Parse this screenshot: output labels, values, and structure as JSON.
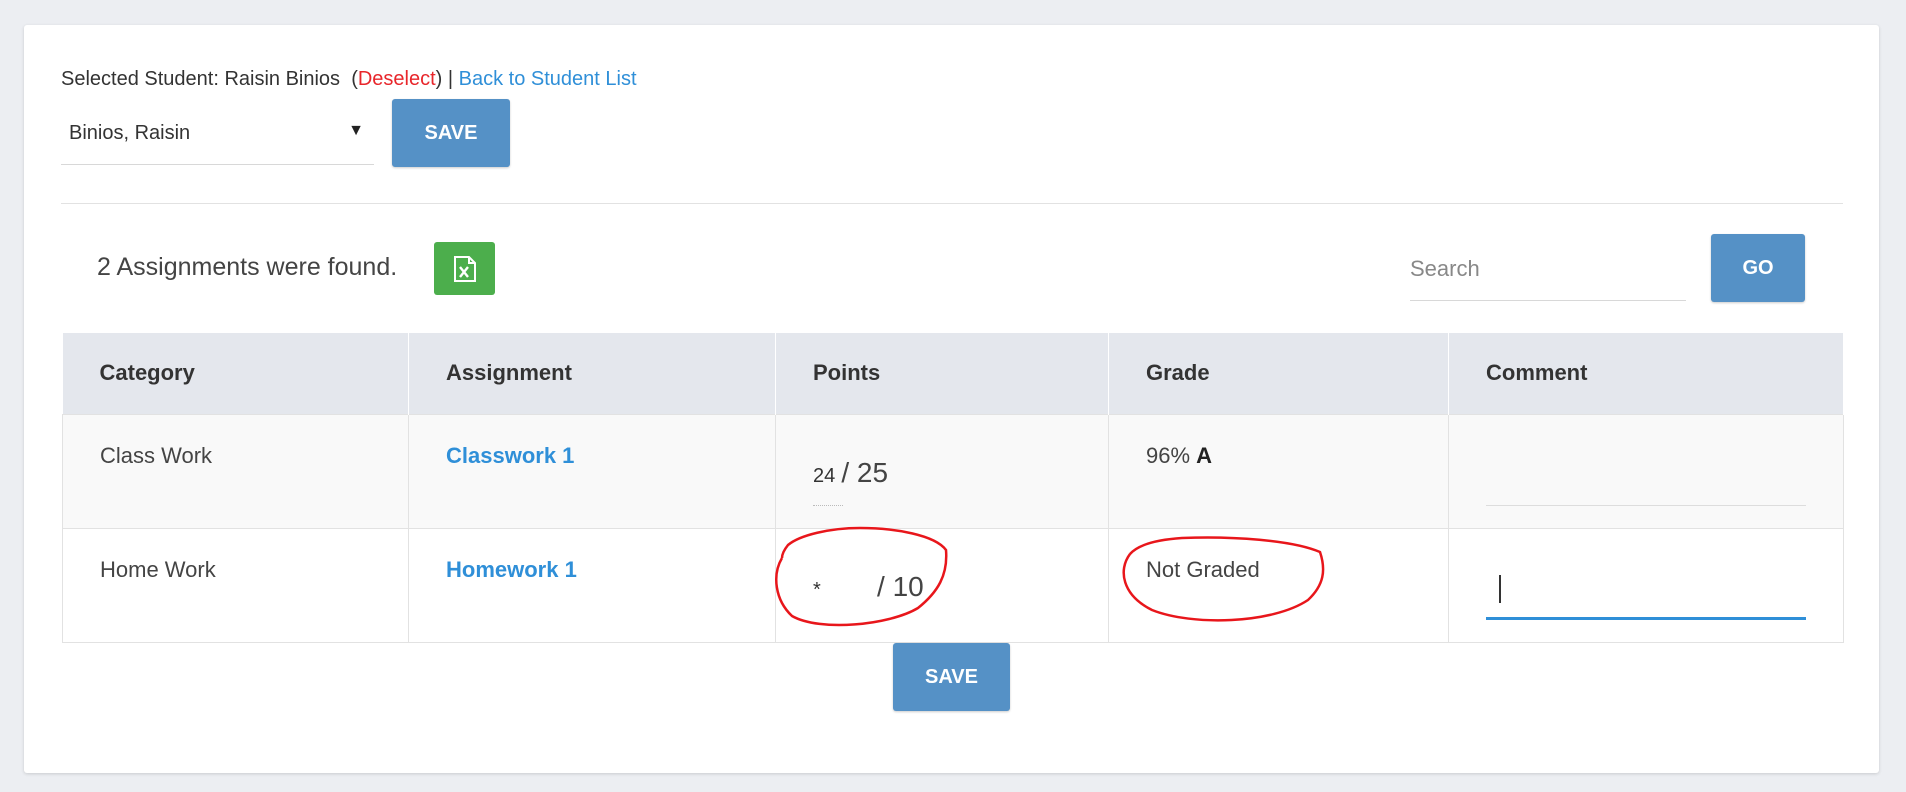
{
  "header": {
    "selected_prefix": "Selected Student: Raisin Binios",
    "open_paren": "(",
    "deselect": "Deselect",
    "close_paren_sep": ") |",
    "back_link": "Back to Student List"
  },
  "student_select": {
    "value": "Binios, Raisin"
  },
  "buttons": {
    "save": "SAVE",
    "go": "GO"
  },
  "summary": {
    "found_text": "2 Assignments were found."
  },
  "search": {
    "placeholder": "Search"
  },
  "table": {
    "headers": [
      "Category",
      "Assignment",
      "Points",
      "Grade",
      "Comment"
    ],
    "rows": [
      {
        "category": "Class Work",
        "assignment": "Classwork 1",
        "points_entered": "24",
        "points_max": "/ 25",
        "grade_pct": "96%",
        "grade_letter": "A",
        "comment": ""
      },
      {
        "category": "Home Work",
        "assignment": "Homework 1",
        "points_entered": "*",
        "points_max": "/ 10",
        "grade_text": "Not Graded",
        "comment": ""
      }
    ]
  },
  "colors": {
    "accent": "#5591c6",
    "link": "#2f8fd8",
    "deselect": "#e8262b",
    "excel": "#4cae4c",
    "annotation": "#e8161b"
  },
  "icons": {
    "export": "excel-icon",
    "dropdown": "caret-down-icon"
  }
}
